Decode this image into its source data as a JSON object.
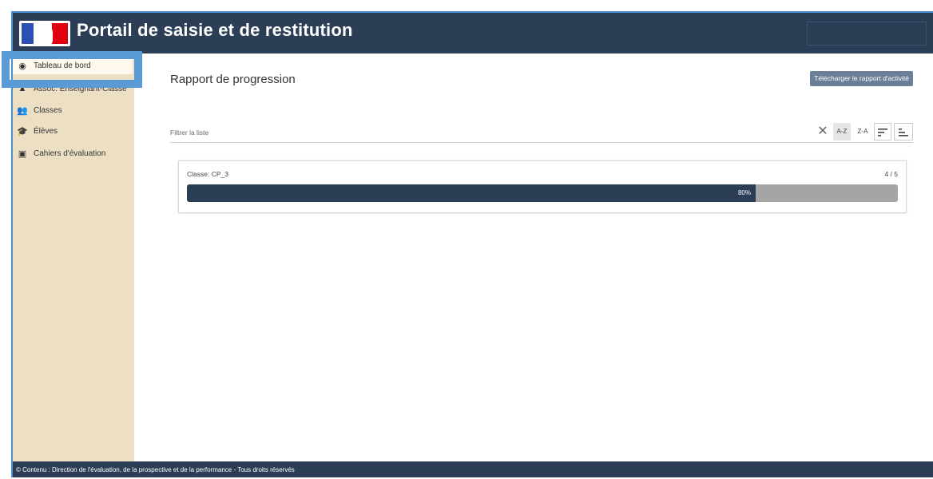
{
  "header": {
    "title": "Portail de saisie et de restitution",
    "logo_icon": "marianne-logo"
  },
  "sidebar": {
    "items": [
      {
        "label": "Tableau de bord",
        "icon": "dashboard-icon",
        "active": true
      },
      {
        "label": "Assoc. Enseignant-Classe",
        "icon": "teacher-icon",
        "active": false
      },
      {
        "label": "Classes",
        "icon": "users-icon",
        "active": false
      },
      {
        "label": "Élèves",
        "icon": "graduation-cap-icon",
        "active": false
      },
      {
        "label": "Cahiers d'évaluation",
        "icon": "notebook-icon",
        "active": false
      }
    ]
  },
  "main": {
    "title": "Rapport de progression",
    "download_label": "Télécharger le rapport d'activité",
    "filter_placeholder": "Filtrer la liste",
    "sort_az_label": "A-Z",
    "sort_za_label": "Z-A",
    "cards": [
      {
        "label": "Classe: CP_3",
        "count": "4 / 5",
        "progress_text": "80%",
        "progress": 0.8
      }
    ]
  },
  "footer": {
    "text": "© Contenu : Direction de l'évaluation, de la prospective et de la performance - Tous droits réservés"
  },
  "colors": {
    "header_bg": "#2c3e55",
    "sidebar_bg": "#ecdfc4",
    "progress_fill": "#2c3e55",
    "progress_track": "#a5a5a5",
    "highlight": "#5b9bd5"
  }
}
